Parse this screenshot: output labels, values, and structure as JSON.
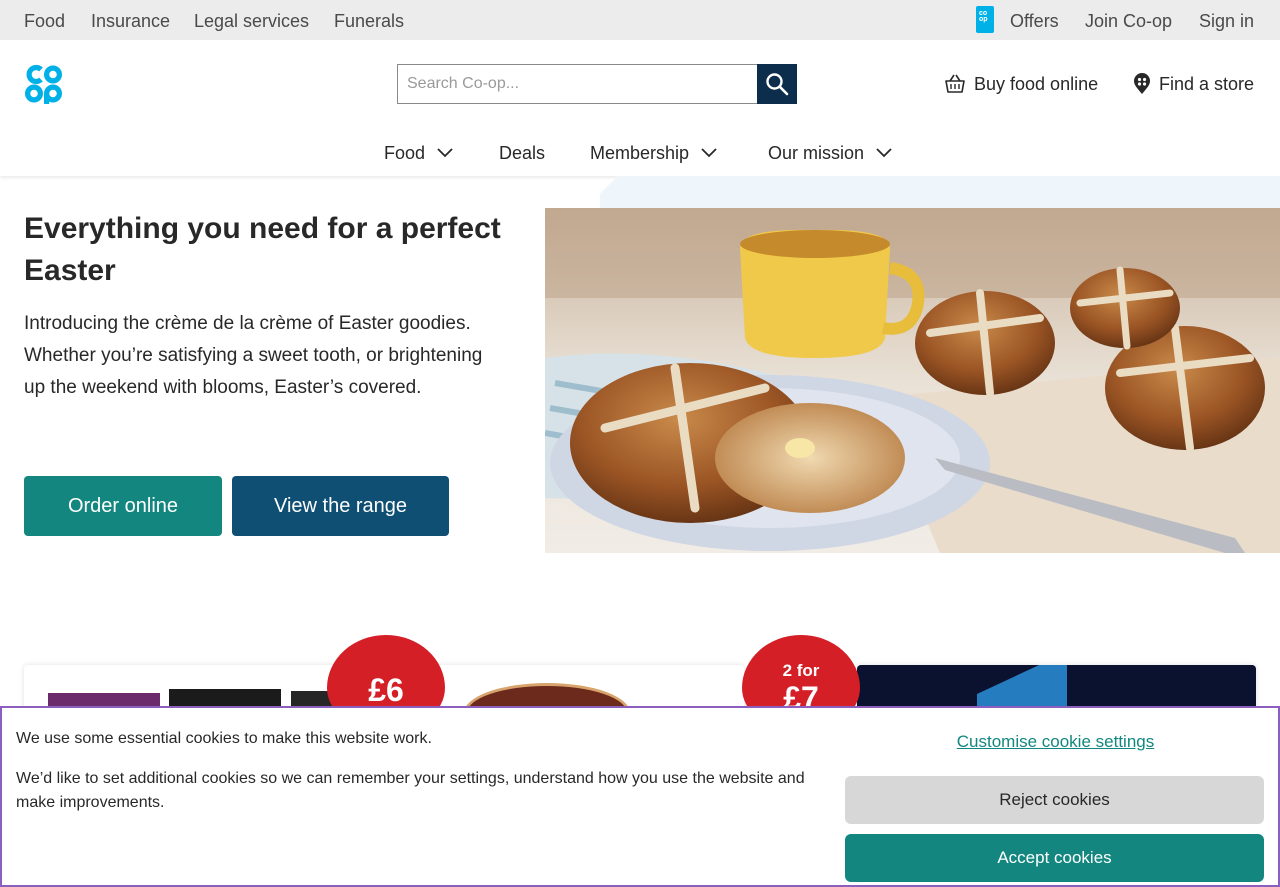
{
  "utility_nav": {
    "items": [
      "Food",
      "Insurance",
      "Legal services",
      "Funerals"
    ],
    "offers": "Offers",
    "join": "Join Co-op",
    "sign_in": "Sign in"
  },
  "header": {
    "logo_text": "co op",
    "search_placeholder": "Search Co-op...",
    "buy_food": "Buy food online",
    "find_store": "Find a store",
    "nav": [
      "Food",
      "Deals",
      "Membership",
      "Our mission"
    ]
  },
  "hero": {
    "title": "Everything you need for a perfect Easter",
    "text": "Introducing the crème de la crème of Easter goodies. Whether you’re satisfying a sweet tooth, or brightening up the weekend with blooms, Easter’s covered.",
    "order_button": "Order online",
    "range_button": "View the range"
  },
  "promos": [
    {
      "badge_price": "£6"
    },
    {
      "badge_prefix": "2 for",
      "badge_price": "£7"
    }
  ],
  "cookie_banner": {
    "line1": "We use some essential cookies to make this website work.",
    "line2": "We’d like to set additional cookies so we can remember your settings, understand how you use the website and make improvements.",
    "customise": "Customise cookie settings",
    "reject": "Reject cookies",
    "accept": "Accept cookies"
  },
  "colors": {
    "brand_blue": "#00b1e7",
    "teal": "#13877f",
    "navy": "#0f4f74",
    "sale_red": "#d41f27",
    "banner_border": "#8c5ebd"
  }
}
